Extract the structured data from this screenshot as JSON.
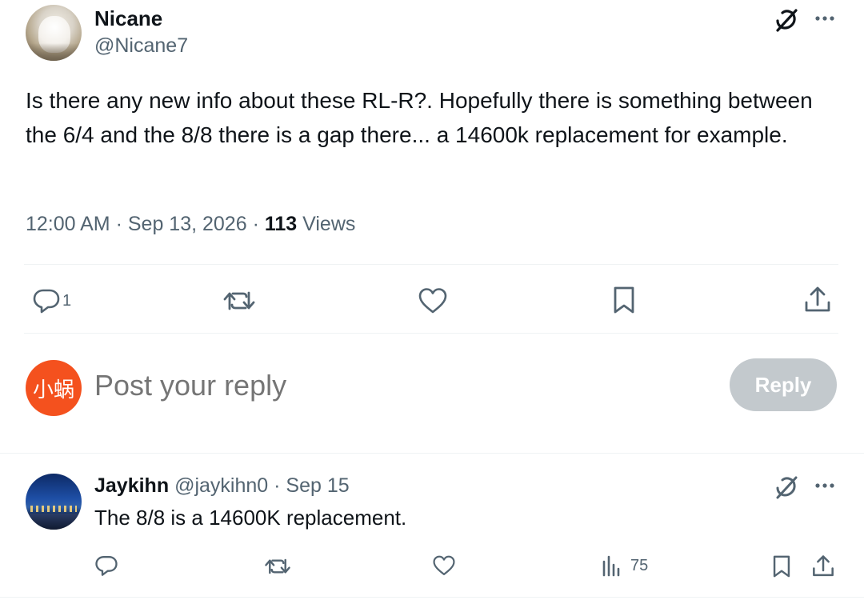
{
  "post": {
    "author_name": "Nicane",
    "author_handle": "@Nicane7",
    "text": "Is there any new info about these RL-R?. Hopefully there is something between the 6/4 and the 8/8 there is a gap there... a 14600k replacement for example.",
    "time": "12:00 AM",
    "date": "Sep 13, 2026",
    "sep": "·",
    "views_count": "113",
    "views_label": "Views",
    "actions": {
      "reply_count": "1"
    }
  },
  "composer": {
    "avatar_text": "小蜗",
    "placeholder": "Post your reply",
    "reply_button": "Reply"
  },
  "reply": {
    "author_name": "Jaykihn",
    "author_handle": "@jaykihn0",
    "sep": "·",
    "date": "Sep 15",
    "text": "The 8/8 is a 14600K replacement.",
    "views_count": "75"
  },
  "colors": {
    "text_primary": "#0f1419",
    "text_secondary": "#536471",
    "divider": "#eff3f4",
    "reply_button_disabled": "#c3c9cd",
    "composer_avatar": "#f4511e"
  },
  "icons": [
    "grok-icon",
    "more-icon",
    "reply-icon",
    "repost-icon",
    "like-icon",
    "bookmark-icon",
    "share-icon",
    "views-icon"
  ]
}
